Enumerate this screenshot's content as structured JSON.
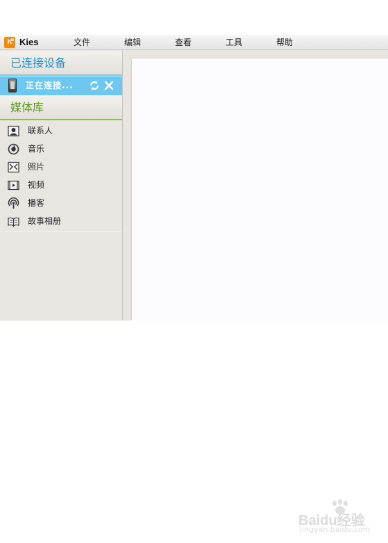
{
  "app": {
    "logo_text": "K",
    "title": "Kies"
  },
  "menu": {
    "file": "文件",
    "edit": "编辑",
    "view": "查看",
    "tools": "工具",
    "help": "帮助"
  },
  "sidebar": {
    "connected_heading": "已连接设备",
    "device_status": "正在连接...",
    "media_heading": "媒体库",
    "media_items": [
      {
        "label": "联系人",
        "icon": "contacts-icon"
      },
      {
        "label": "音乐",
        "icon": "music-icon"
      },
      {
        "label": "照片",
        "icon": "photo-icon"
      },
      {
        "label": "视频",
        "icon": "video-icon"
      },
      {
        "label": "播客",
        "icon": "podcast-icon"
      },
      {
        "label": "故事相册",
        "icon": "story-album-icon"
      }
    ]
  },
  "watermark": {
    "text": "Baidu经验",
    "sub": "jingyan.baidu.com"
  },
  "colors": {
    "accent_blue": "#2a8ec5",
    "device_row": "#6ec7f1",
    "media_green": "#5a9a19",
    "logo_orange": "#f08a12"
  }
}
